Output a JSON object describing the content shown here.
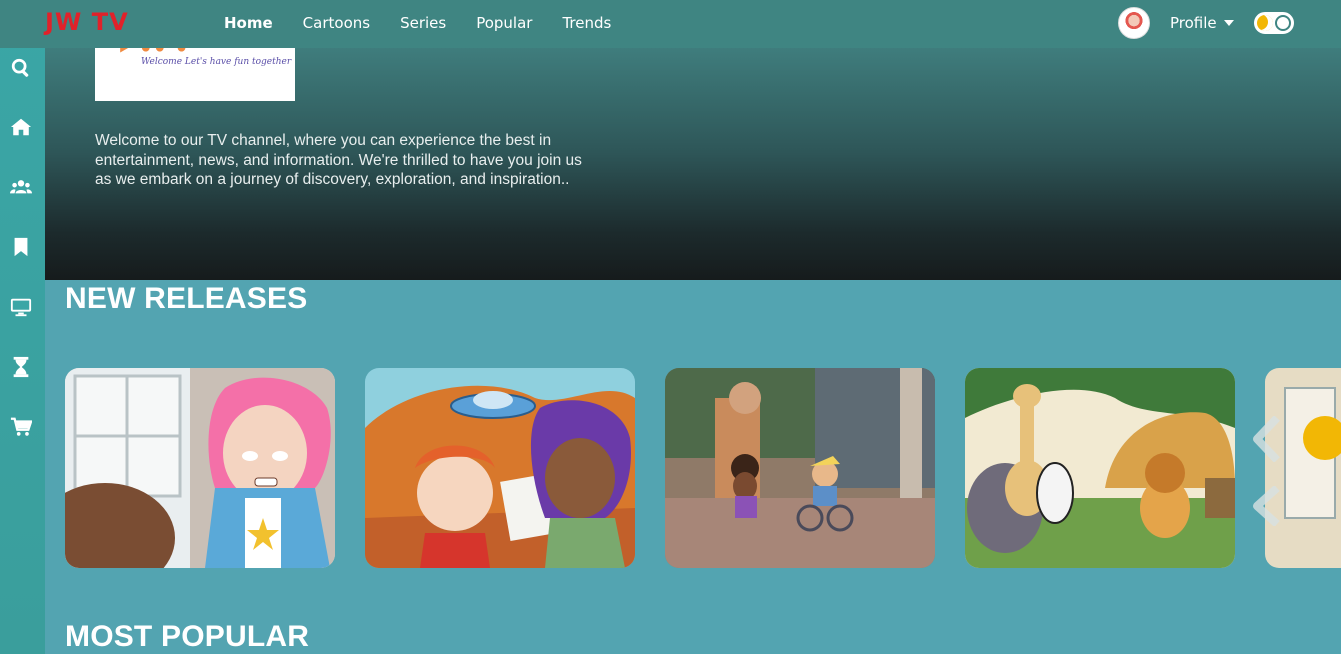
{
  "brand": {
    "logo_text": "JW TV",
    "logo_color": "#e0222a"
  },
  "nav": {
    "links": [
      "Home",
      "Cartoons",
      "Series",
      "Popular",
      "Trends"
    ],
    "active": "Home",
    "profile_label": "Profile"
  },
  "sidebar": {
    "icons": [
      "search-icon",
      "home-icon",
      "users-icon",
      "bookmark-icon",
      "tv-icon",
      "hourglass-icon",
      "cart-icon"
    ]
  },
  "hero": {
    "logo_tagline": "Welcome Let's have fun together",
    "description": "Welcome to our TV channel, where you can experience the best in entertainment, news, and information. We're thrilled to have you join us as we embark on a journey of discovery, exploration, and inspiration.."
  },
  "sections": {
    "new_releases": "NEW RELEASES",
    "most_popular": "MOST POPULAR"
  },
  "colors": {
    "accent": "#53a4b1",
    "topbar": "#3f8582",
    "sidebar": "#3aa6a6",
    "toggle_moon": "#f2b705"
  }
}
